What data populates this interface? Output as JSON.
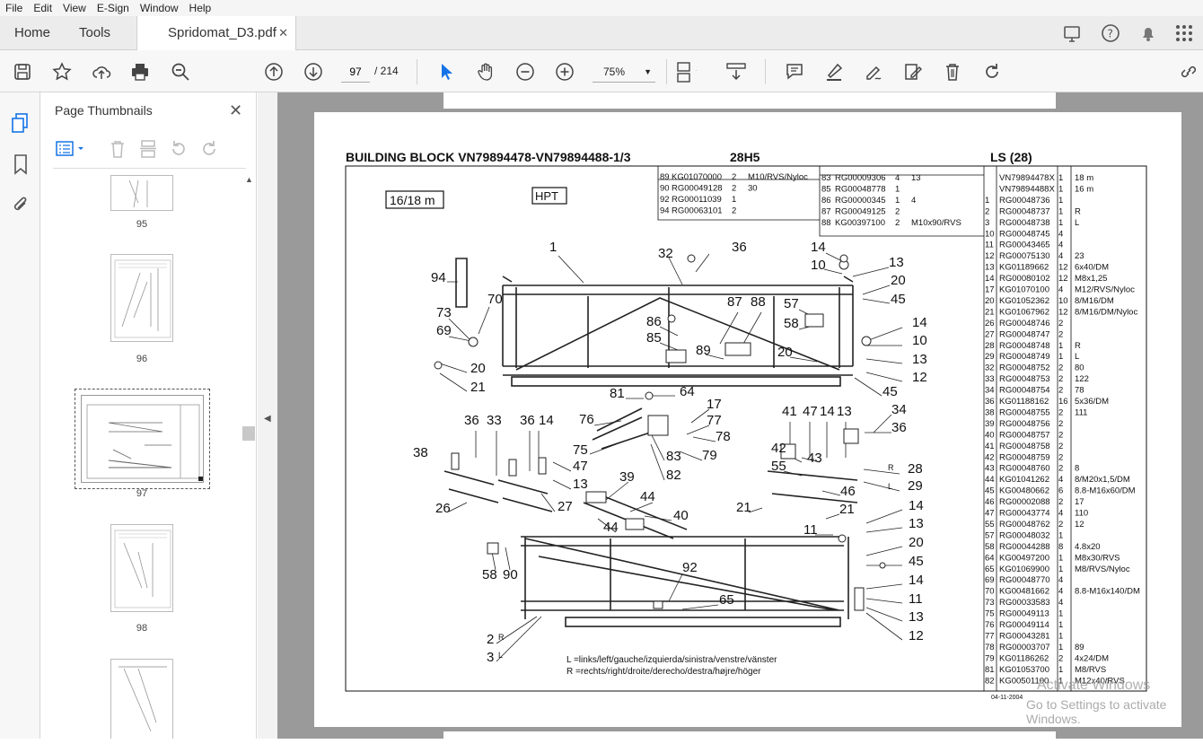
{
  "menu": [
    "File",
    "Edit",
    "View",
    "E-Sign",
    "Window",
    "Help"
  ],
  "tabs": {
    "home": "Home",
    "tools": "Tools",
    "file": "Spridomat_D3.pdf"
  },
  "nav": {
    "current_page": "97",
    "total": "/ 214",
    "zoom": "75%"
  },
  "thumbs": {
    "title": "Page Thumbnails",
    "labels": [
      "95",
      "96",
      "97",
      "98"
    ]
  },
  "drawing": {
    "title_left": "BUILDING  BLOCK  VN79894478-VN79894488-1/3",
    "title_mid": "28H5",
    "title_right": "LS  (28)",
    "box_size": "16/18  m",
    "box_hpt": "HPT",
    "legend_l": "L  =links/left/gauche/izquierda/sinistra/venstre/vänster",
    "legend_r": "R  =rechts/right/droite/derecho/destra/højre/höger",
    "date": "04-11-2004",
    "table_a": [
      [
        "89",
        "KG01070000",
        "2",
        "M10/RVS/Nyloc"
      ],
      [
        "90",
        "RG00049128",
        "2",
        "30"
      ],
      [
        "92",
        "RG00011039",
        "1",
        ""
      ],
      [
        "94",
        "RG00063101",
        "2",
        ""
      ]
    ],
    "table_b": [
      [
        "83",
        "RG00009306",
        "4",
        "13"
      ],
      [
        "85",
        "RG00048778",
        "1",
        ""
      ],
      [
        "86",
        "RG00000345",
        "1",
        "4"
      ],
      [
        "87",
        "RG00049125",
        "2",
        ""
      ],
      [
        "88",
        "KG00397100",
        "2",
        "M10x90/RVS"
      ]
    ],
    "parts": [
      [
        "",
        "VN79894478X",
        "1",
        "18 m"
      ],
      [
        "",
        "VN79894488X",
        "1",
        "16 m"
      ],
      [
        "1",
        "RG00048736",
        "1",
        ""
      ],
      [
        "2",
        "RG00048737",
        "1",
        "R"
      ],
      [
        "3",
        "RG00048738",
        "1",
        "L"
      ],
      [
        "10",
        "RG00048745",
        "4",
        ""
      ],
      [
        "11",
        "RG00043465",
        "4",
        ""
      ],
      [
        "12",
        "RG00075130",
        "4",
        "23"
      ],
      [
        "13",
        "KG01189662",
        "12",
        "6x40/DM"
      ],
      [
        "14",
        "RG00080102",
        "12",
        "M8x1,25"
      ],
      [
        "17",
        "KG01070100",
        "4",
        "M12/RVS/Nyloc"
      ],
      [
        "20",
        "KG01052362",
        "10",
        "8/M16/DM"
      ],
      [
        "21",
        "KG01067962",
        "12",
        "8/M16/DM/Nyloc"
      ],
      [
        "26",
        "RG00048746",
        "2",
        ""
      ],
      [
        "27",
        "RG00048747",
        "2",
        ""
      ],
      [
        "28",
        "RG00048748",
        "1",
        "R"
      ],
      [
        "29",
        "RG00048749",
        "1",
        "L"
      ],
      [
        "32",
        "RG00048752",
        "2",
        "80"
      ],
      [
        "33",
        "RG00048753",
        "2",
        "122"
      ],
      [
        "34",
        "RG00048754",
        "2",
        "78"
      ],
      [
        "36",
        "KG01188162",
        "16",
        "5x36/DM"
      ],
      [
        "38",
        "RG00048755",
        "2",
        "111"
      ],
      [
        "39",
        "RG00048756",
        "2",
        ""
      ],
      [
        "40",
        "RG00048757",
        "2",
        ""
      ],
      [
        "41",
        "RG00048758",
        "2",
        ""
      ],
      [
        "42",
        "RG00048759",
        "2",
        ""
      ],
      [
        "43",
        "RG00048760",
        "2",
        "8"
      ],
      [
        "44",
        "KG01041262",
        "4",
        "8/M20x1,5/DM"
      ],
      [
        "45",
        "KG00480662",
        "6",
        "8.8-M16x60/DM"
      ],
      [
        "46",
        "RG00002088",
        "2",
        "17"
      ],
      [
        "47",
        "RG00043774",
        "4",
        "110"
      ],
      [
        "55",
        "RG00048762",
        "2",
        "12"
      ],
      [
        "57",
        "RG00048032",
        "1",
        ""
      ],
      [
        "58",
        "RG00044288",
        "8",
        "4.8x20"
      ],
      [
        "64",
        "KG00497200",
        "1",
        "M8x30/RVS"
      ],
      [
        "65",
        "KG01069900",
        "1",
        "M8/RVS/Nyloc"
      ],
      [
        "69",
        "RG00048770",
        "4",
        ""
      ],
      [
        "70",
        "KG00481662",
        "4",
        "8.8-M16x140/DM"
      ],
      [
        "73",
        "RG00033583",
        "4",
        ""
      ],
      [
        "75",
        "RG00049113",
        "1",
        ""
      ],
      [
        "76",
        "RG00049114",
        "1",
        ""
      ],
      [
        "77",
        "RG00043281",
        "1",
        ""
      ],
      [
        "78",
        "RG00003707",
        "1",
        "89"
      ],
      [
        "79",
        "KG01186262",
        "2",
        "4x24/DM"
      ],
      [
        "81",
        "KG01053700",
        "1",
        "M8/RVS"
      ],
      [
        "82",
        "KG00501100",
        "1",
        "M12x40/RVS"
      ]
    ],
    "callouts": [
      [
        "1",
        612,
        280
      ],
      [
        "32",
        733,
        287
      ],
      [
        "36",
        815,
        280
      ],
      [
        "14",
        903,
        280
      ],
      [
        "10",
        903,
        300
      ],
      [
        "13",
        990,
        297
      ],
      [
        "20",
        992,
        317
      ],
      [
        "45",
        992,
        338
      ],
      [
        "94",
        480,
        314
      ],
      [
        "70",
        543,
        338
      ],
      [
        "73",
        486,
        353
      ],
      [
        "69",
        486,
        373
      ],
      [
        "20",
        524,
        415
      ],
      [
        "21",
        524,
        436
      ],
      [
        "86",
        720,
        363
      ],
      [
        "85",
        720,
        381
      ],
      [
        "87",
        810,
        341
      ],
      [
        "88",
        836,
        341
      ],
      [
        "89",
        775,
        395
      ],
      [
        "57",
        873,
        343
      ],
      [
        "58",
        873,
        365
      ],
      [
        "20",
        866,
        397
      ],
      [
        "14",
        1016,
        364
      ],
      [
        "10",
        1016,
        384
      ],
      [
        "13",
        1016,
        405
      ],
      [
        "12",
        1016,
        425
      ],
      [
        "45",
        983,
        441
      ],
      [
        "81",
        679,
        443
      ],
      [
        "64",
        757,
        441
      ],
      [
        "17",
        787,
        455
      ],
      [
        "76",
        645,
        472
      ],
      [
        "77",
        787,
        473
      ],
      [
        "78",
        797,
        491
      ],
      [
        "75",
        638,
        506
      ],
      [
        "79",
        782,
        512
      ],
      [
        "83",
        742,
        513
      ],
      [
        "82",
        742,
        534
      ],
      [
        "36",
        517,
        473
      ],
      [
        "33",
        542,
        473
      ],
      [
        "36",
        579,
        473
      ],
      [
        "14",
        600,
        473
      ],
      [
        "38",
        460,
        509
      ],
      [
        "47",
        638,
        524
      ],
      [
        "13",
        638,
        544
      ],
      [
        "26",
        485,
        571
      ],
      [
        "27",
        621,
        569
      ],
      [
        "39",
        690,
        536
      ],
      [
        "44",
        713,
        558
      ],
      [
        "40",
        750,
        579
      ],
      [
        "44",
        672,
        592
      ],
      [
        "41",
        871,
        463
      ],
      [
        "47",
        894,
        463
      ],
      [
        "14",
        913,
        463
      ],
      [
        "13",
        932,
        463
      ],
      [
        "34",
        993,
        461
      ],
      [
        "36",
        993,
        481
      ],
      [
        "42",
        859,
        504
      ],
      [
        "43",
        899,
        515
      ],
      [
        "55",
        859,
        524
      ],
      [
        "28",
        1011,
        527
      ],
      [
        "29",
        1011,
        546
      ],
      [
        "46",
        936,
        552
      ],
      [
        "21",
        820,
        570
      ],
      [
        "21",
        935,
        572
      ],
      [
        "11",
        895,
        595
      ],
      [
        "14",
        1012,
        568
      ],
      [
        "13",
        1012,
        588
      ],
      [
        "20",
        1012,
        609
      ],
      [
        "45",
        1012,
        630
      ],
      [
        "58",
        537,
        645
      ],
      [
        "90",
        560,
        645
      ],
      [
        "92",
        760,
        637
      ],
      [
        "65",
        801,
        673
      ],
      [
        "14",
        1012,
        651
      ],
      [
        "11",
        1012,
        672
      ],
      [
        "13",
        1012,
        692
      ],
      [
        "12",
        1012,
        713
      ],
      [
        "2",
        542,
        717
      ],
      [
        "3",
        542,
        737
      ]
    ]
  },
  "watermark": {
    "line1": "Activate Windows",
    "line2": "Go to Settings to activate Windows."
  },
  "colors": {
    "accent": "#1473e6",
    "doc_bg": "#9a9a9a"
  }
}
